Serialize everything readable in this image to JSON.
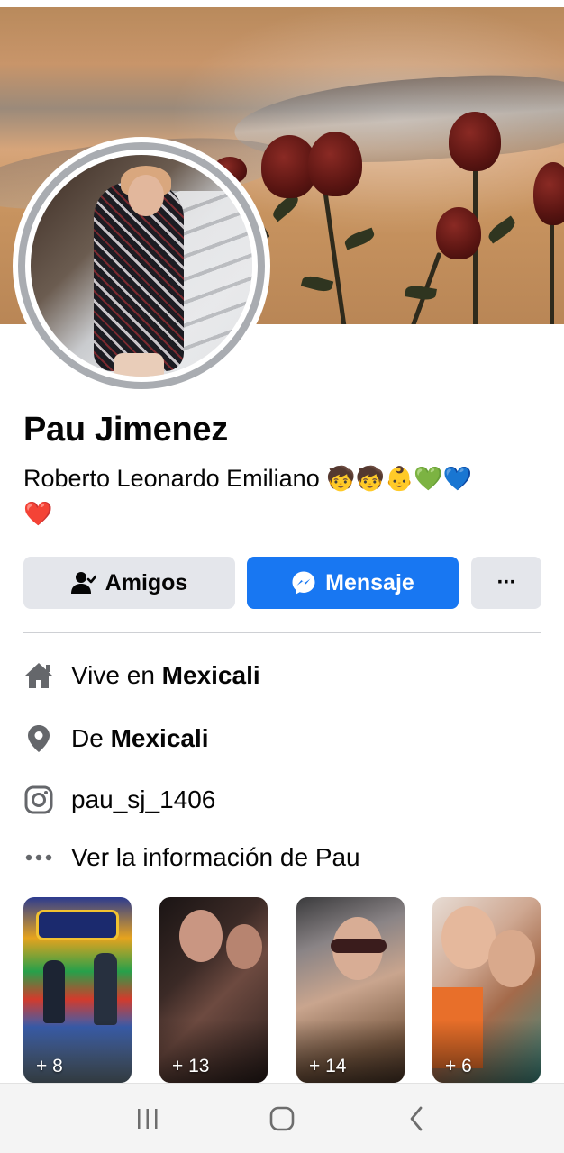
{
  "profile": {
    "name": "Pau Jimenez",
    "bio_text": "Roberto Leonardo Emiliano",
    "bio_emojis": "🧒🧒👶💚💙",
    "bio_emoji_line2": "❤️"
  },
  "actions": {
    "friends_label": "Amigos",
    "message_label": "Mensaje",
    "more_label": "···"
  },
  "info": {
    "lives_prefix": "Vive en ",
    "lives_city": "Mexicali",
    "from_prefix": "De ",
    "from_city": "Mexicali",
    "instagram": "pau_sj_1406",
    "see_more": "Ver la información de Pau"
  },
  "highlights": [
    {
      "count": "+ 8"
    },
    {
      "count": "+ 13"
    },
    {
      "count": "+ 14"
    },
    {
      "count": "+ 6"
    }
  ],
  "icons": {
    "friends": "person-check-icon",
    "message": "messenger-icon",
    "more": "more-horizontal-icon",
    "home": "home-icon",
    "location": "location-pin-icon",
    "instagram": "instagram-icon",
    "dots": "more-dots-icon",
    "nav_recents": "recents-icon",
    "nav_home": "home-circle-icon",
    "nav_back": "back-chevron-icon"
  },
  "colors": {
    "accent": "#1877f2",
    "button_gray": "#e4e6eb",
    "avatar_ring": "#a9acb1"
  }
}
